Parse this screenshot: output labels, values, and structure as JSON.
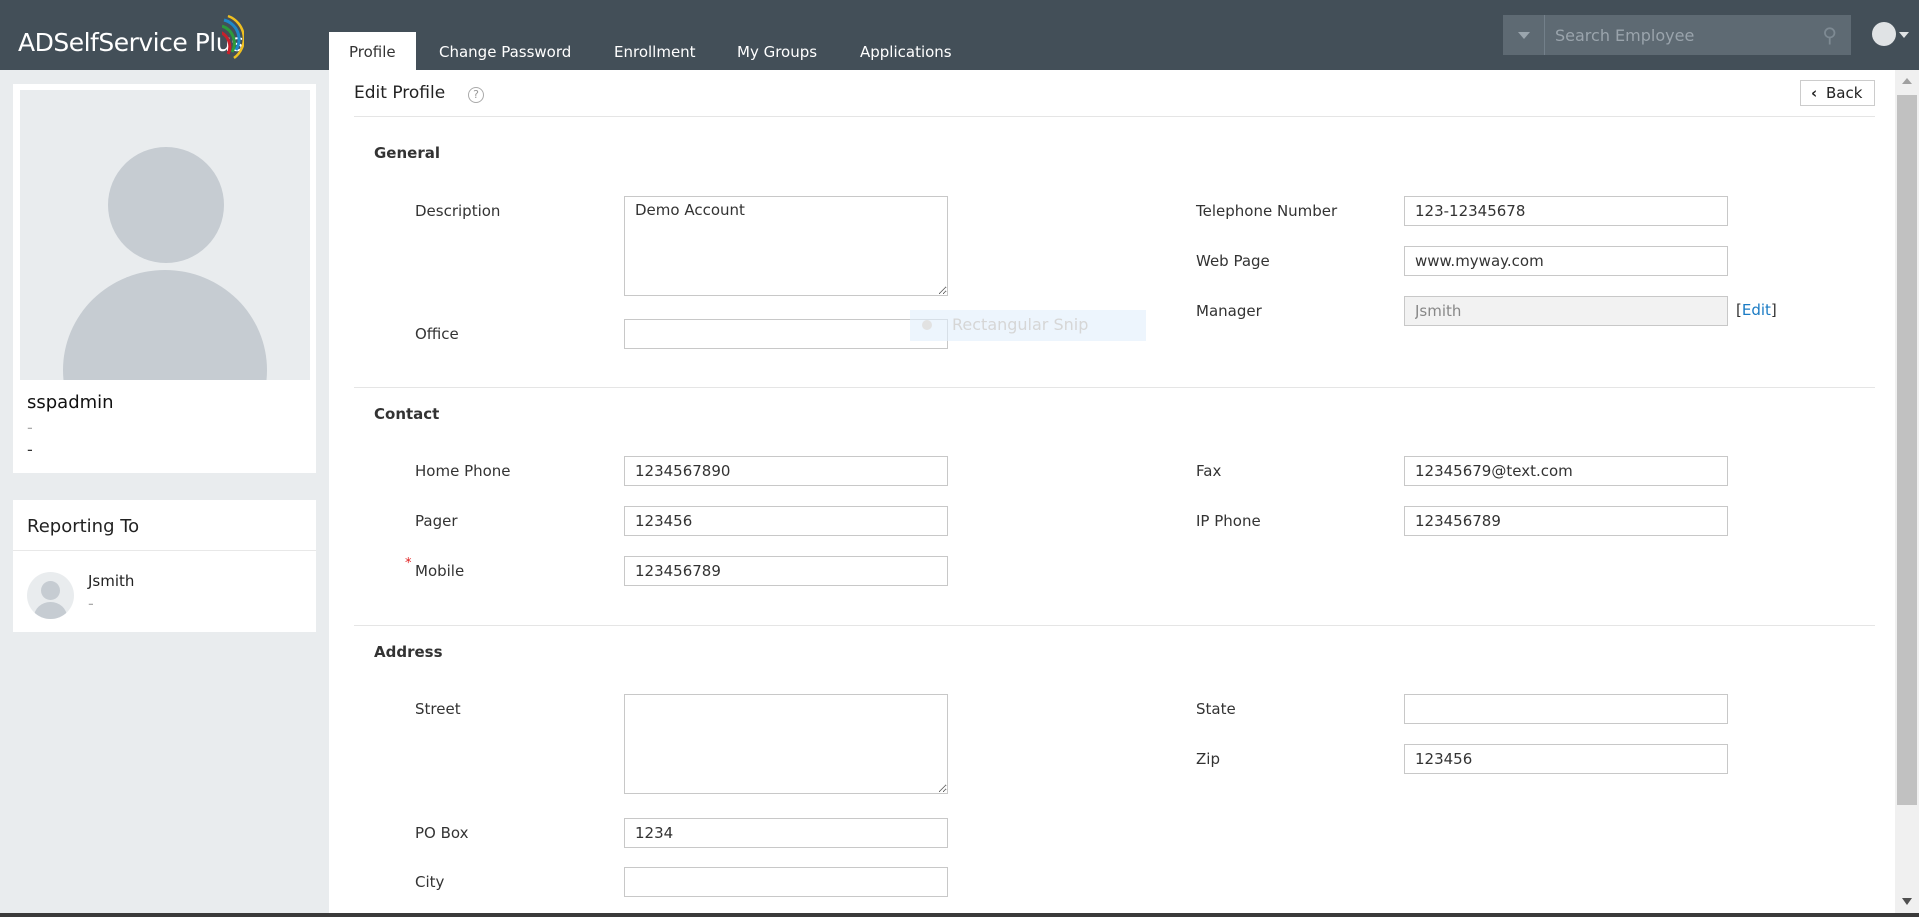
{
  "app": {
    "title": "ADSelfService Plus"
  },
  "tabs": [
    {
      "label": "Profile",
      "active": true
    },
    {
      "label": "Change Password"
    },
    {
      "label": "Enrollment"
    },
    {
      "label": "My Groups"
    },
    {
      "label": "Applications"
    }
  ],
  "search": {
    "placeholder": "Search Employee"
  },
  "profile": {
    "name": "sspadmin",
    "line1": "-",
    "line2": "-"
  },
  "reporting": {
    "title": "Reporting To",
    "name": "Jsmith",
    "sub": "-"
  },
  "page": {
    "title": "Edit Profile",
    "back": "Back"
  },
  "general": {
    "heading": "General",
    "description": {
      "label": "Description",
      "value": "Demo Account"
    },
    "office": {
      "label": "Office",
      "value": ""
    },
    "telephone": {
      "label": "Telephone Number",
      "value": "123-12345678"
    },
    "webpage": {
      "label": "Web Page",
      "value": "www.myway.com"
    },
    "manager": {
      "label": "Manager",
      "value": "Jsmith",
      "edit": "Edit"
    }
  },
  "contact": {
    "heading": "Contact",
    "home_phone": {
      "label": "Home Phone",
      "value": "1234567890"
    },
    "pager": {
      "label": "Pager",
      "value": "123456"
    },
    "mobile": {
      "label": "Mobile",
      "value": "123456789",
      "required": "*"
    },
    "fax": {
      "label": "Fax",
      "value": "12345679@text.com"
    },
    "ip_phone": {
      "label": "IP Phone",
      "value": "123456789"
    }
  },
  "address": {
    "heading": "Address",
    "street": {
      "label": "Street",
      "value": ""
    },
    "po_box": {
      "label": "PO Box",
      "value": "1234"
    },
    "city": {
      "label": "City",
      "value": ""
    },
    "state": {
      "label": "State",
      "value": ""
    },
    "zip": {
      "label": "Zip",
      "value": "123456"
    }
  },
  "overlay": {
    "snip": "Rectangular Snip"
  },
  "colors": {
    "header": "#434f58",
    "sidebar": "#e9ecee",
    "link": "#1a7bc4",
    "required": "#e02020"
  }
}
